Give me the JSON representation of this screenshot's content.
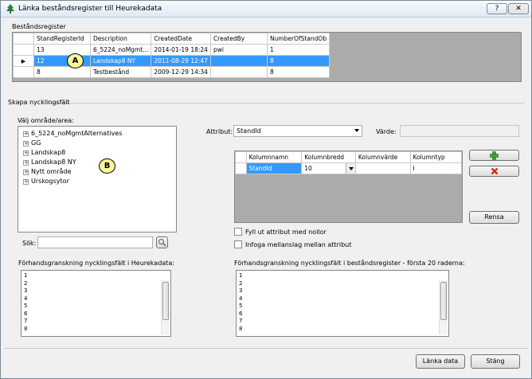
{
  "window": {
    "title": "Länka beståndsregister till Heurekadata",
    "help_label": "?",
    "close_label": "✕"
  },
  "stand_register": {
    "section_label": "Beståndsregister",
    "columns": [
      "StandRegisterId",
      "Description",
      "CreatedDate",
      "CreatedBy",
      "NumberOfStandOb"
    ],
    "rows": [
      {
        "indicator": "",
        "cells": [
          "13",
          "6_5224_noMgmt...",
          "2014-01-19 18:24",
          "pwi",
          "1"
        ]
      },
      {
        "indicator": "▶",
        "cells": [
          "12",
          "Landskap8 NY",
          "2011-08-29 12:47",
          "",
          "8"
        ]
      },
      {
        "indicator": "",
        "cells": [
          "8",
          "Testbestånd",
          "2009-12-29 14:34",
          "",
          "8"
        ]
      }
    ],
    "selected_row_index": 1
  },
  "key_field": {
    "section_label": "Skapa nycklingsfält",
    "area_label": "Välj område/area:",
    "tree_items": [
      "6_5224_noMgmtAlternatives",
      "GG",
      "Landskap8",
      "Landskap8 NY",
      "Nytt område",
      "Urskogsytor"
    ],
    "search_label": "Sök:",
    "attribute_label": "Attribut:",
    "attribute_value": "StandId",
    "value_label": "Värde:",
    "columns_table": {
      "headers": [
        "Kolumnnamn",
        "Kolumnbredd",
        "Kolumnvärde",
        "Kolumntyp"
      ],
      "rows": [
        [
          "StandId",
          "10",
          "",
          "I"
        ]
      ]
    },
    "clear_button": "Rensa",
    "fill_zeros_label": "Fyll ut attribut med nollor",
    "insert_spaces_label": "Infoga mellanslag mellan attribut",
    "preview_heureka_label": "Förhandsgranskning nycklingsfält i Heurekadata:",
    "preview_register_label": "Förhandsgranskning nycklingsfält i beståndsregister - första 20 raderna:",
    "preview_lines": [
      "1",
      "2",
      "3",
      "4",
      "5",
      "6",
      "7",
      "8"
    ]
  },
  "footer": {
    "link_button": "Länka data",
    "close_button": "Stäng"
  },
  "callouts": {
    "a": "A",
    "b": "B"
  },
  "colors": {
    "selection": "#3399ff",
    "callout_fill": "#fdf59a"
  },
  "icons": {
    "add": "green-plus-icon",
    "remove": "red-x-icon",
    "search": "magnifier-icon"
  }
}
